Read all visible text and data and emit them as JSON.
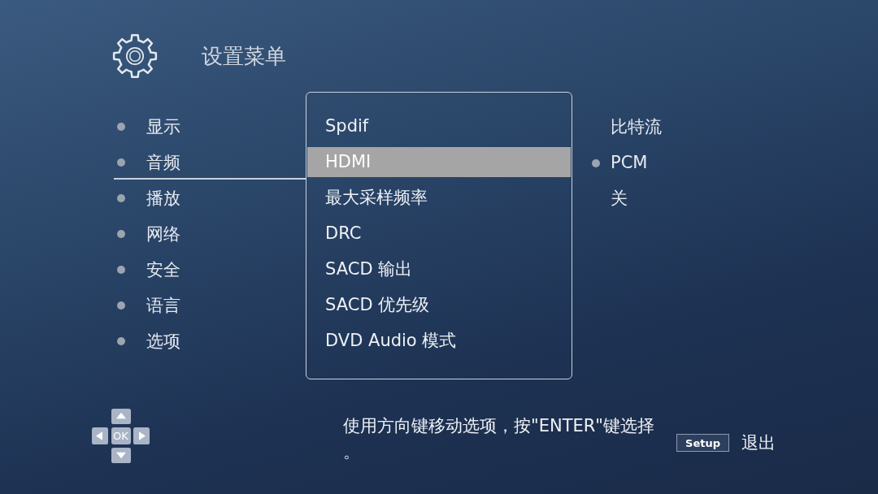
{
  "header": {
    "title": "设置菜单"
  },
  "categories": [
    {
      "label": "显示",
      "selected": false
    },
    {
      "label": "音频",
      "selected": true
    },
    {
      "label": "播放",
      "selected": false
    },
    {
      "label": "网络",
      "selected": false
    },
    {
      "label": "安全",
      "selected": false
    },
    {
      "label": "语言",
      "selected": false
    },
    {
      "label": "选项",
      "selected": false
    }
  ],
  "submenu": {
    "items": [
      {
        "label": "Spdif",
        "selected": false
      },
      {
        "label": "HDMI",
        "selected": true
      },
      {
        "label": "最大采样频率",
        "selected": false
      },
      {
        "label": "DRC",
        "selected": false
      },
      {
        "label": "SACD 输出",
        "selected": false
      },
      {
        "label": "SACD 优先级",
        "selected": false
      },
      {
        "label": "DVD Audio 模式",
        "selected": false
      }
    ]
  },
  "options": [
    {
      "label": "比特流",
      "selected": false
    },
    {
      "label": "PCM",
      "selected": true
    },
    {
      "label": "关",
      "selected": false
    }
  ],
  "dpad": {
    "center": "OK"
  },
  "hint": "使用方向键移动选项，按\"ENTER\"键选择。",
  "exit": {
    "key": "Setup",
    "label": "退出"
  }
}
